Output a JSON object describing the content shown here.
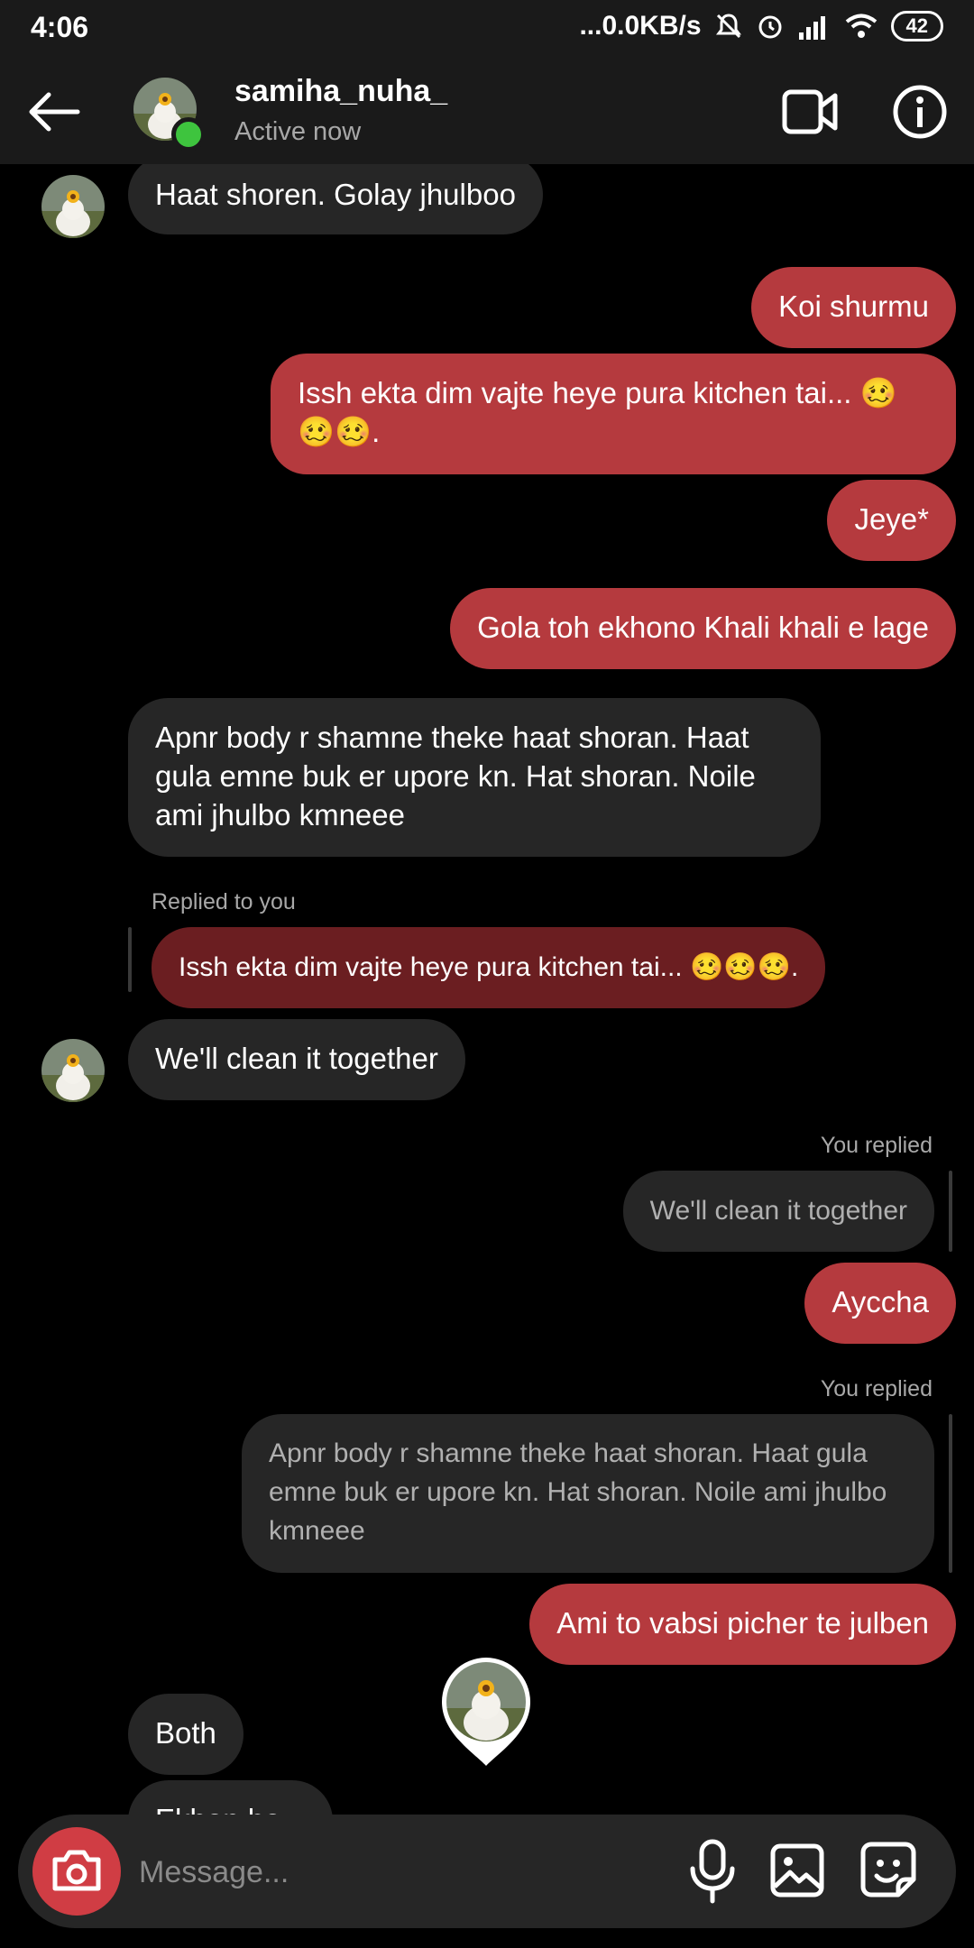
{
  "status_bar": {
    "time": "4:06",
    "network_speed": "...0.0KB/s",
    "battery": "42"
  },
  "header": {
    "username": "samiha_nuha_",
    "status": "Active now",
    "icons": [
      "back-arrow-icon",
      "video-call-icon",
      "info-icon"
    ]
  },
  "messages": [
    {
      "from": "them",
      "text": "Haat shoren. Golay jhulboo"
    },
    {
      "from": "me",
      "text": "Koi shurmu"
    },
    {
      "from": "me",
      "text": "Issh ekta dim vajte heye pura kitchen tai... 🥴🥴🥴."
    },
    {
      "from": "me",
      "text": "Jeye*"
    },
    {
      "from": "me",
      "text": "Gola toh ekhono Khali khali e lage"
    },
    {
      "from": "them",
      "text": "Apnr body r shamne theke haat shoran. Haat gula emne buk er upore kn. Hat shoran. Noile ami jhulbo kmneee"
    },
    {
      "from": "them",
      "reply_label": "Replied to you",
      "quoted": "Issh ekta dim vajte heye pura kitchen tai... 🥴🥴🥴.",
      "text": "We'll clean it together"
    },
    {
      "from": "me",
      "reply_label": "You replied",
      "quoted": "We'll clean it together",
      "text": "Ayccha"
    },
    {
      "from": "me",
      "reply_label": "You replied",
      "quoted": "Apnr body r shamne theke haat shoran. Haat gula emne buk er upore kn. Hat shoran. Noile ami jhulbo kmneee",
      "text": "Ami to vabsi picher te julben"
    },
    {
      "from": "them",
      "text": "Both"
    },
    {
      "from": "them",
      "text": "Ekhon ho..."
    }
  ],
  "composer": {
    "placeholder": "Message...",
    "icons": [
      "camera-icon",
      "microphone-icon",
      "gallery-icon",
      "sticker-icon"
    ]
  },
  "colors": {
    "outgoing_bubble": "#b53a3e",
    "incoming_bubble": "#262626",
    "quoted_outgoing": "#6b1e21",
    "online": "#3ec43e",
    "camera_button": "#d03d44"
  }
}
